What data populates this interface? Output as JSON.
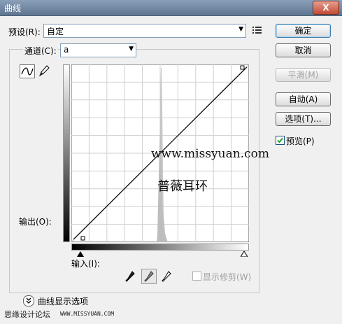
{
  "window": {
    "title": "曲线",
    "close_label": "X"
  },
  "preset": {
    "label": "预设(R):",
    "value": "自定"
  },
  "channel": {
    "label": "通道(C):",
    "value": "a"
  },
  "output_label": "输出(O):",
  "input_label": "输入(I):",
  "buttons": {
    "ok": "确定",
    "cancel": "取消",
    "smooth": "平滑(M)",
    "auto": "自动(A)",
    "options": "选项(T)..."
  },
  "preview": {
    "label": "预览(P)",
    "checked": true
  },
  "show_clipping": {
    "label": "显示修剪(W)",
    "checked": false
  },
  "curve_display_options": "曲线显示选项",
  "watermark": {
    "url": "www.missyuan.com",
    "name": "普薇耳环",
    "footer_left": "思缘设计论坛",
    "footer_right": "WWW.MISSYUAN.COM"
  },
  "curve": {
    "points": [
      [
        0,
        0
      ],
      [
        255,
        255
      ]
    ],
    "grid_divisions": 10
  },
  "colors": {
    "accent": "#3c7fb1",
    "histogram": "#c8c8c8"
  }
}
